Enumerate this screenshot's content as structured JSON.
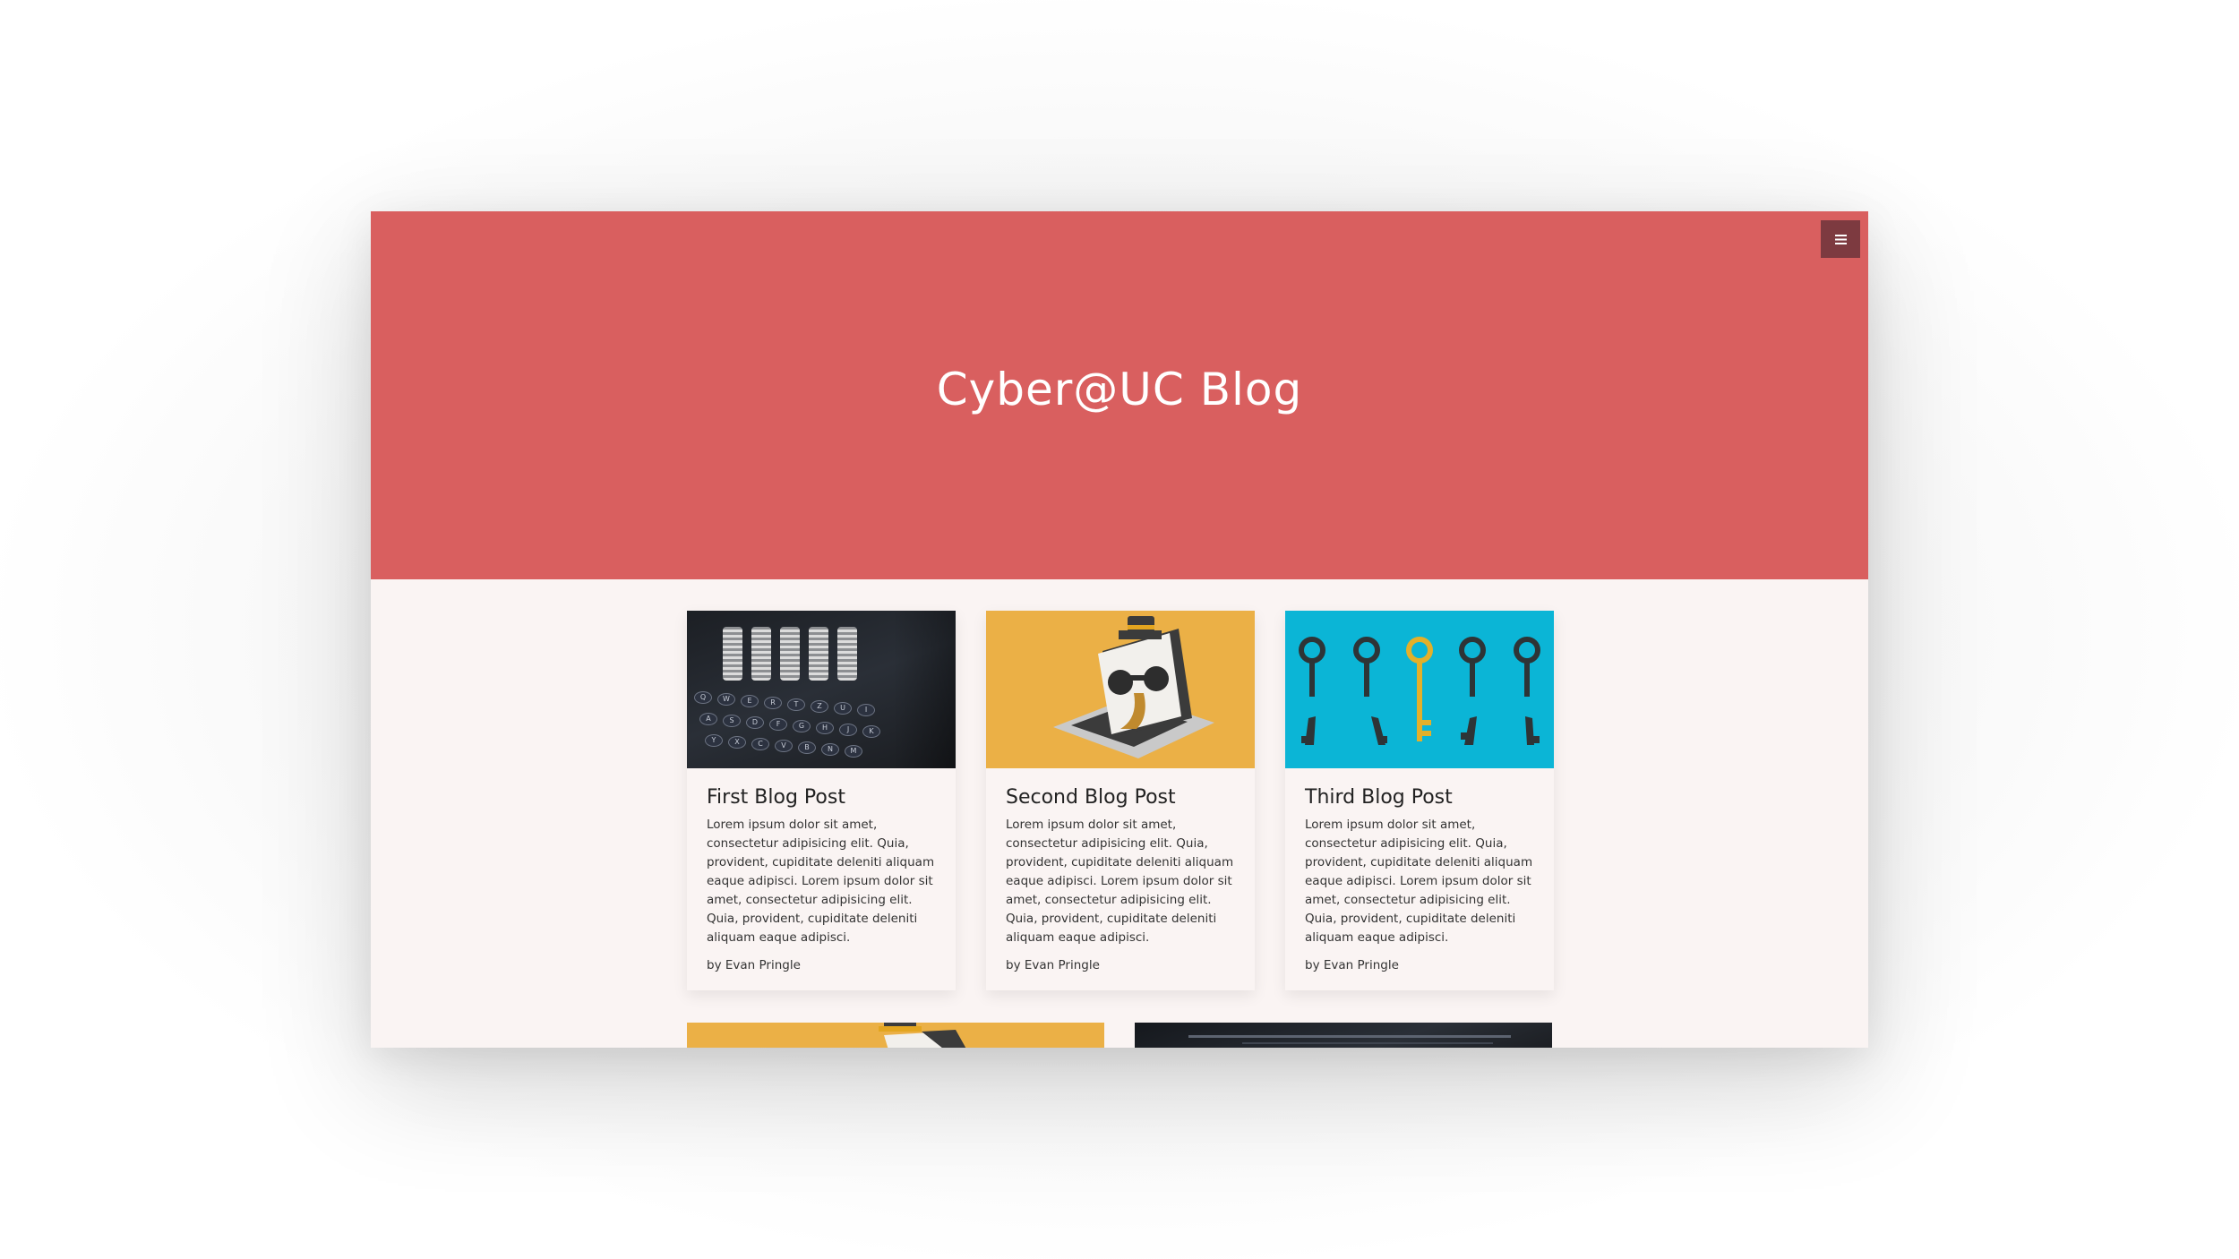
{
  "header": {
    "title": "Cyber@UC Blog"
  },
  "posts": [
    {
      "title": "First Blog Post",
      "excerpt": "Lorem ipsum dolor sit amet, consectetur adipisicing elit. Quia, provident, cupiditate deleniti aliquam eaque adipisci. Lorem ipsum dolor sit amet, consectetur adipisicing elit. Quia, provident, cupiditate deleniti aliquam eaque adipisci.",
      "author": "by Evan Pringle",
      "image": "typewriter-keys-image"
    },
    {
      "title": "Second Blog Post",
      "excerpt": "Lorem ipsum dolor sit amet, consectetur adipisicing elit. Quia, provident, cupiditate deleniti aliquam eaque adipisci. Lorem ipsum dolor sit amet, consectetur adipisicing elit. Quia, provident, cupiditate deleniti aliquam eaque adipisci.",
      "author": "by Evan Pringle",
      "image": "spy-laptop-image"
    },
    {
      "title": "Third Blog Post",
      "excerpt": "Lorem ipsum dolor sit amet, consectetur adipisicing elit. Quia, provident, cupiditate deleniti aliquam eaque adipisci. Lorem ipsum dolor sit amet, consectetur adipisicing elit. Quia, provident, cupiditate deleniti aliquam eaque adipisci.",
      "author": "by Evan Pringle",
      "image": "keys-image"
    }
  ],
  "icons": {
    "menu": "menu-icon"
  },
  "colors": {
    "hero": "#d95f5f",
    "menu_button": "#7d3a40",
    "page_background": "#faf4f3",
    "image_yellow": "#ebb046",
    "image_cyan": "#0bb5d6"
  }
}
